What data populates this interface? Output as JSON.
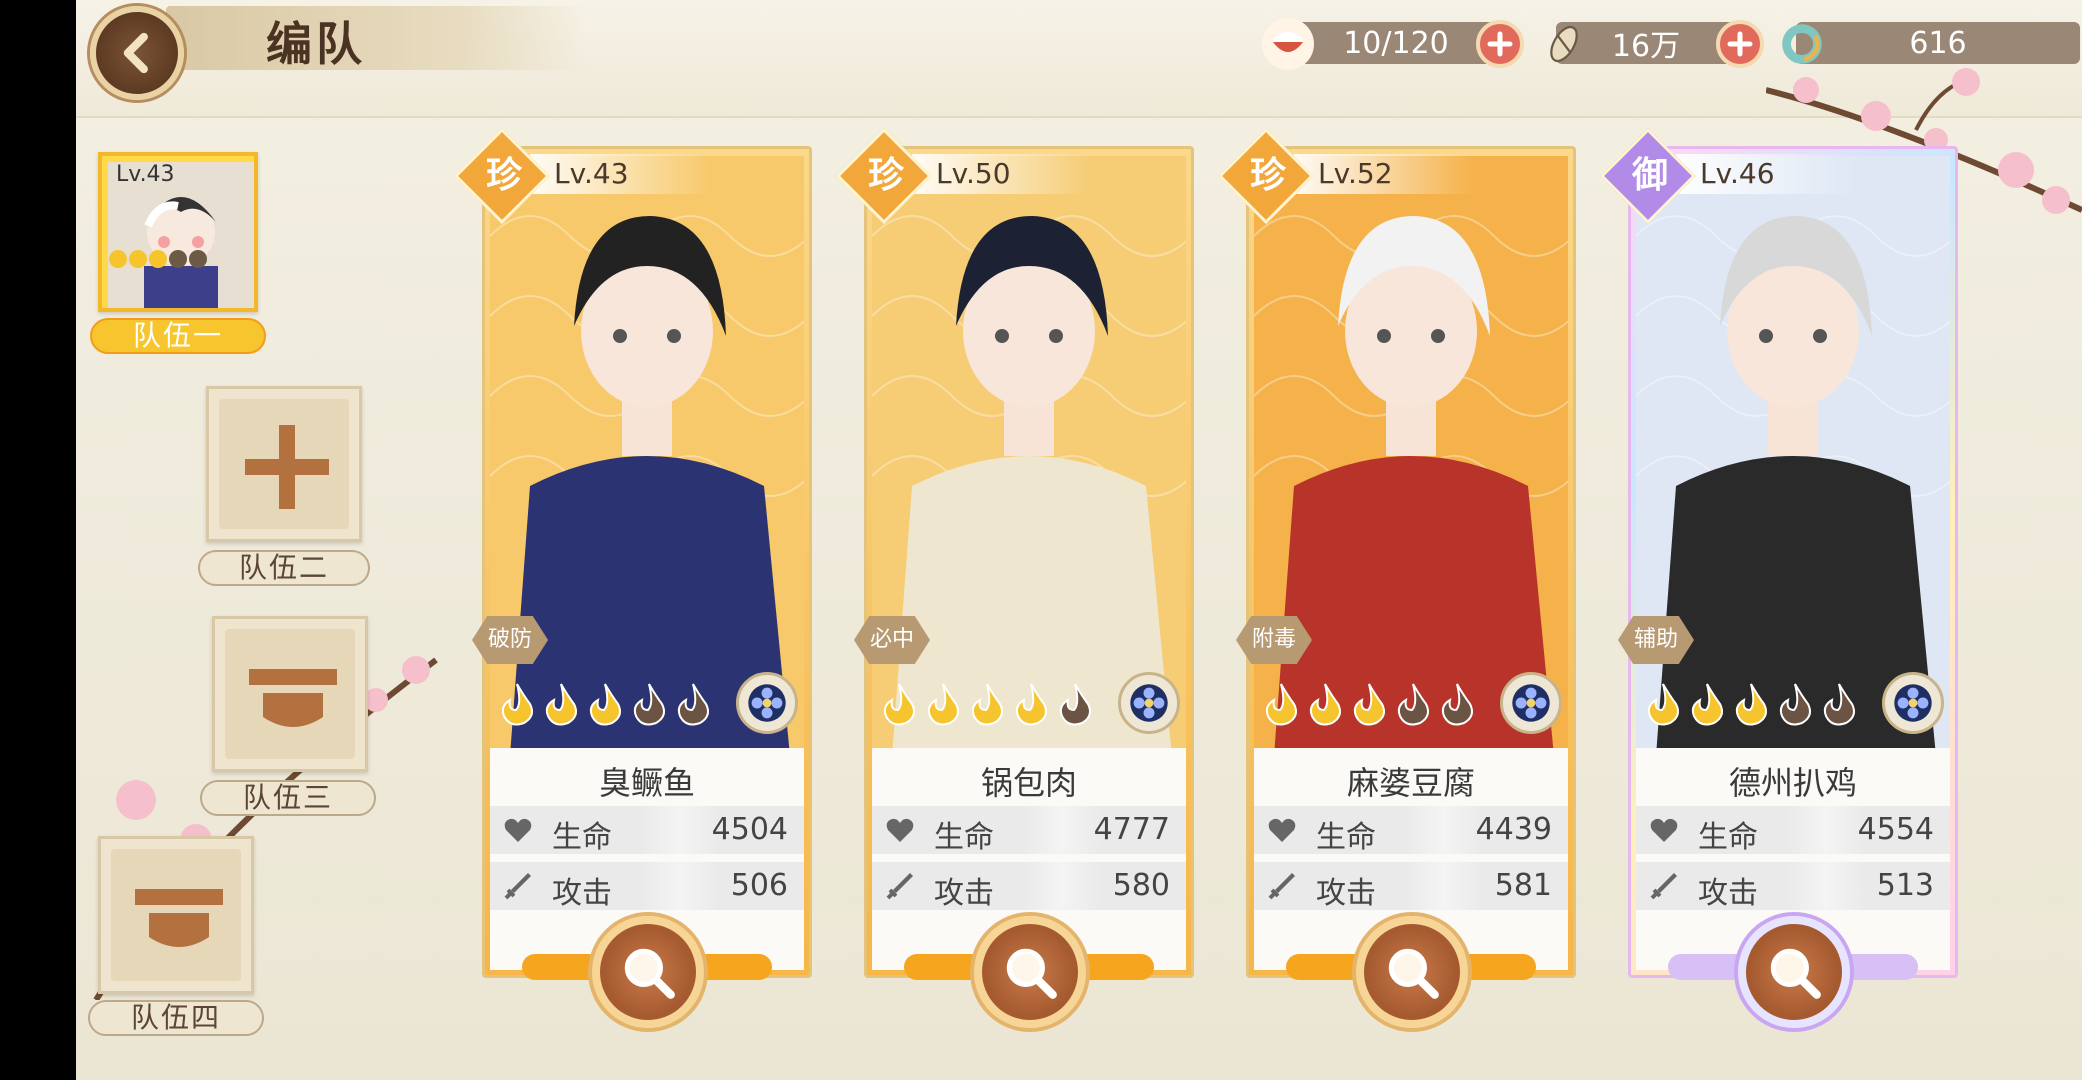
{
  "header": {
    "title": "编队",
    "resources": [
      {
        "name": "food",
        "value": "10/120",
        "icon": "rice-bowl-icon"
      },
      {
        "name": "coin",
        "value": "16万",
        "icon": "coin-icon"
      },
      {
        "name": "gem",
        "value": "616",
        "icon": "gem-ring-icon"
      }
    ]
  },
  "teams": [
    {
      "label": "队伍一",
      "active": true,
      "avatar_level": "Lv.43"
    },
    {
      "label": "队伍二",
      "active": false,
      "state": "add"
    },
    {
      "label": "队伍三",
      "active": false,
      "state": "locked"
    },
    {
      "label": "队伍四",
      "active": false,
      "state": "locked"
    }
  ],
  "cards": [
    {
      "rarity": "珍",
      "level": "Lv.43",
      "role": "破防",
      "name": "臭鳜鱼",
      "stats": [
        {
          "label": "生命",
          "value": "4504"
        },
        {
          "label": "攻击",
          "value": "506"
        }
      ],
      "stars": 3
    },
    {
      "rarity": "珍",
      "level": "Lv.50",
      "role": "必中",
      "name": "锅包肉",
      "stats": [
        {
          "label": "生命",
          "value": "4777"
        },
        {
          "label": "攻击",
          "value": "580"
        }
      ],
      "stars": 4
    },
    {
      "rarity": "珍",
      "level": "Lv.52",
      "role": "附毒",
      "name": "麻婆豆腐",
      "stats": [
        {
          "label": "生命",
          "value": "4439"
        },
        {
          "label": "攻击",
          "value": "581"
        }
      ],
      "stars": 3
    },
    {
      "rarity": "御",
      "level": "Lv.46",
      "role": "辅助",
      "name": "德州扒鸡",
      "stats": [
        {
          "label": "生命",
          "value": "4554"
        },
        {
          "label": "攻击",
          "value": "513"
        }
      ],
      "stars": 3
    }
  ],
  "colors": {
    "accent": "#f6a51e",
    "brown": "#a65a30",
    "panel": "#efe6d2"
  }
}
